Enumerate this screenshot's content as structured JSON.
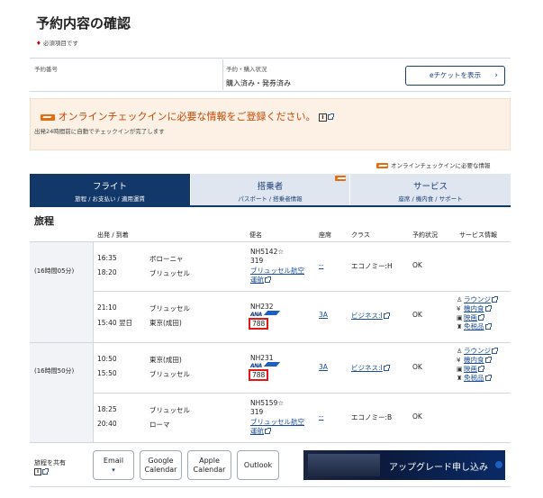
{
  "page": {
    "title": "予約内容の確認",
    "required_note": "必須項目です",
    "required_mark": "♦"
  },
  "booking": {
    "number_label": "予約番号",
    "number_value": "",
    "status_label": "予約・購入状況",
    "status_value": "購入済み・発券済み",
    "eticket_button": "eチケットを表示",
    "eticket_chevron": "›"
  },
  "notice": {
    "title": "オンラインチェックインに必要な情報をご登録ください。",
    "subtitle": "出発24時間前に自動でチェックインが完了します"
  },
  "legend": {
    "text": "オンラインチェックインに必要な情報"
  },
  "tabs": [
    {
      "label": "フライト",
      "sub": "旅程 / お支払い / 適用運賃",
      "active": true
    },
    {
      "label": "搭乗者",
      "sub": "パスポート / 搭乗者情報",
      "active": false
    },
    {
      "label": "サービス",
      "sub": "座席 / 機内食 / サポート",
      "active": false
    }
  ],
  "itinerary": {
    "heading": "旅程",
    "columns": [
      "出発 / 到着",
      "便名",
      "座席",
      "クラス",
      "予約状況",
      "サービス情報"
    ],
    "groups": [
      {
        "duration": "(16時間05分)",
        "segments": [
          {
            "dep_time": "16:35",
            "arr_time": "18:20",
            "dep_city": "ボローニャ",
            "arr_city": "ブリュッセル",
            "flight_no": "NH5142☆",
            "sub_no": "319",
            "operator": "ブリュッセル航空",
            "operator2": "運航",
            "seat": "--",
            "class": "エコノミー:H",
            "status": "OK"
          },
          {
            "dep_time": "21:10",
            "arr_time": "15:40 翌日",
            "dep_city": "ブリュッセル",
            "arr_city": "東京(成田)",
            "flight_no": "NH232",
            "aircraft": "788",
            "seat": "3A",
            "class": "ビジネス:I",
            "status": "OK",
            "services": [
              "ラウンジ",
              "機内食",
              "映画",
              "免税品"
            ]
          }
        ]
      },
      {
        "duration": "(16時間50分)",
        "segments": [
          {
            "dep_time": "10:50",
            "arr_time": "15:50",
            "dep_city": "東京(成田)",
            "arr_city": "ブリュッセル",
            "flight_no": "NH231",
            "aircraft": "788",
            "seat": "3A",
            "class": "ビジネス:I",
            "status": "OK",
            "services": [
              "ラウンジ",
              "機内食",
              "映画",
              "免税品"
            ]
          },
          {
            "dep_time": "18:25",
            "arr_time": "20:40",
            "dep_city": "ブリュッセル",
            "arr_city": "ローマ",
            "flight_no": "NH5159☆",
            "sub_no": "319",
            "operator": "ブリュッセル航空",
            "operator2": "運航",
            "seat": "--",
            "class": "エコノミー:B",
            "status": "OK"
          }
        ]
      }
    ]
  },
  "share": {
    "label": "旅程を共有",
    "buttons": [
      {
        "line1": "Email",
        "line2": "▾"
      },
      {
        "line1": "Google",
        "line2": "Calendar"
      },
      {
        "line1": "Apple",
        "line2": "Calendar"
      },
      {
        "line1": "Outlook",
        "line2": ""
      }
    ],
    "banner": "アップグレード申し込み"
  }
}
